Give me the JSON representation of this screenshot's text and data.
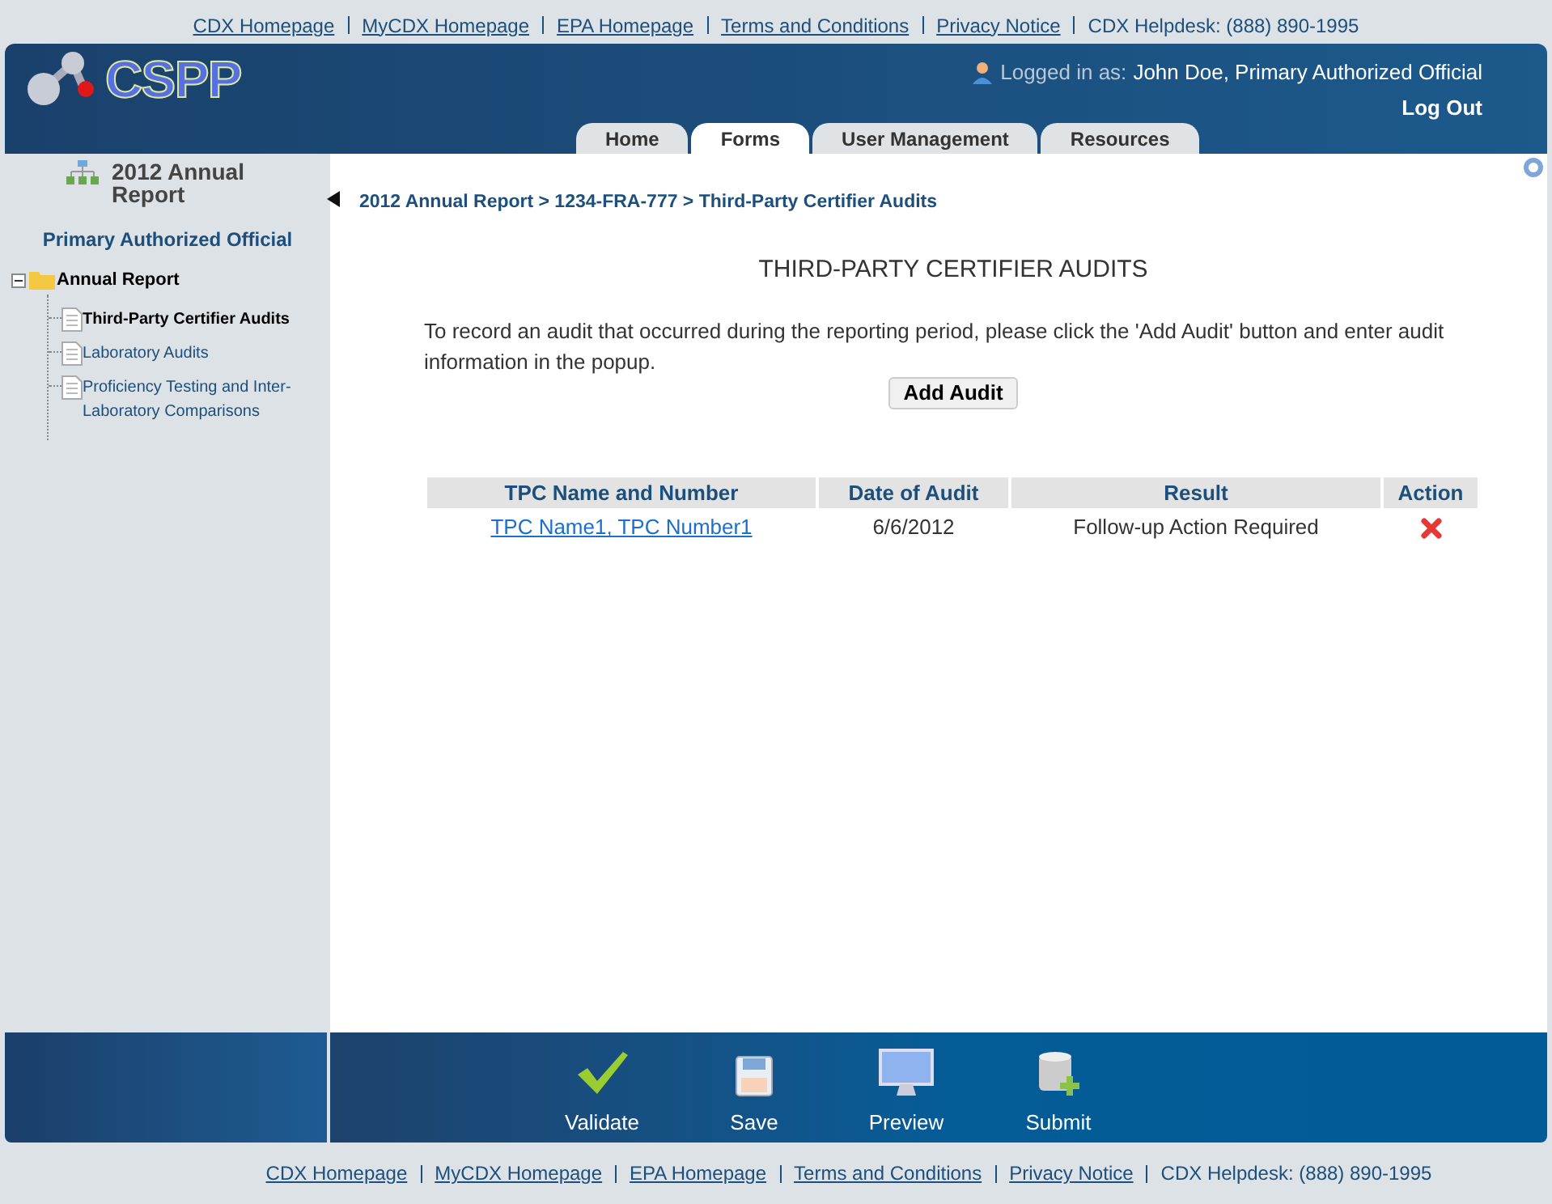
{
  "top_links": [
    "CDX Homepage",
    "MyCDX Homepage",
    "EPA Homepage",
    "Terms and Conditions",
    "Privacy Notice"
  ],
  "top_helpdesk": "CDX Helpdesk: (888) 890-1995",
  "logo": "CSPP",
  "user": {
    "prefix": "Logged in as:",
    "name": "John Doe, Primary Authorized Official",
    "logout": "Log Out"
  },
  "tabs": [
    {
      "label": "Home",
      "selected": false
    },
    {
      "label": "Forms",
      "selected": true
    },
    {
      "label": "User Management",
      "selected": false
    },
    {
      "label": "Resources",
      "selected": false
    }
  ],
  "sidebar": {
    "title": "2012 Annual Report",
    "role": "Primary Authorized Official",
    "tree": {
      "label": "Annual Report",
      "expanded": true,
      "children": [
        {
          "label": "Third-Party Certifier Audits",
          "selected": true
        },
        {
          "label": "Laboratory Audits",
          "selected": false
        },
        {
          "label": "Proficiency Testing and Inter-Laboratory Comparisons",
          "selected": false
        }
      ]
    }
  },
  "breadcrumb": "2012 Annual Report > 1234-FRA-777 > Third-Party Certifier Audits",
  "heading": "THIRD-PARTY CERTIFIER AUDITS",
  "instructions": "To record an audit that occurred during the reporting period, please click the 'Add Audit' button and enter audit information in the popup.",
  "add_button": "Add Audit",
  "table": {
    "columns": [
      "TPC Name and Number",
      "Date of Audit",
      "Result",
      "Action"
    ],
    "rows": [
      {
        "name": "TPC Name1, TPC Number1",
        "date": "6/6/2012",
        "result": "Follow-up Action Required"
      }
    ]
  },
  "toolbar": [
    {
      "label": "Validate",
      "kind": "validate"
    },
    {
      "label": "Save",
      "kind": "save"
    },
    {
      "label": "Preview",
      "kind": "preview"
    },
    {
      "label": "Submit",
      "kind": "submit"
    }
  ],
  "bottom_links": [
    "CDX Homepage",
    "MyCDX Homepage",
    "EPA Homepage",
    "Terms and Conditions",
    "Privacy Notice"
  ],
  "bottom_helpdesk": "CDX Helpdesk: (888) 890-1995"
}
